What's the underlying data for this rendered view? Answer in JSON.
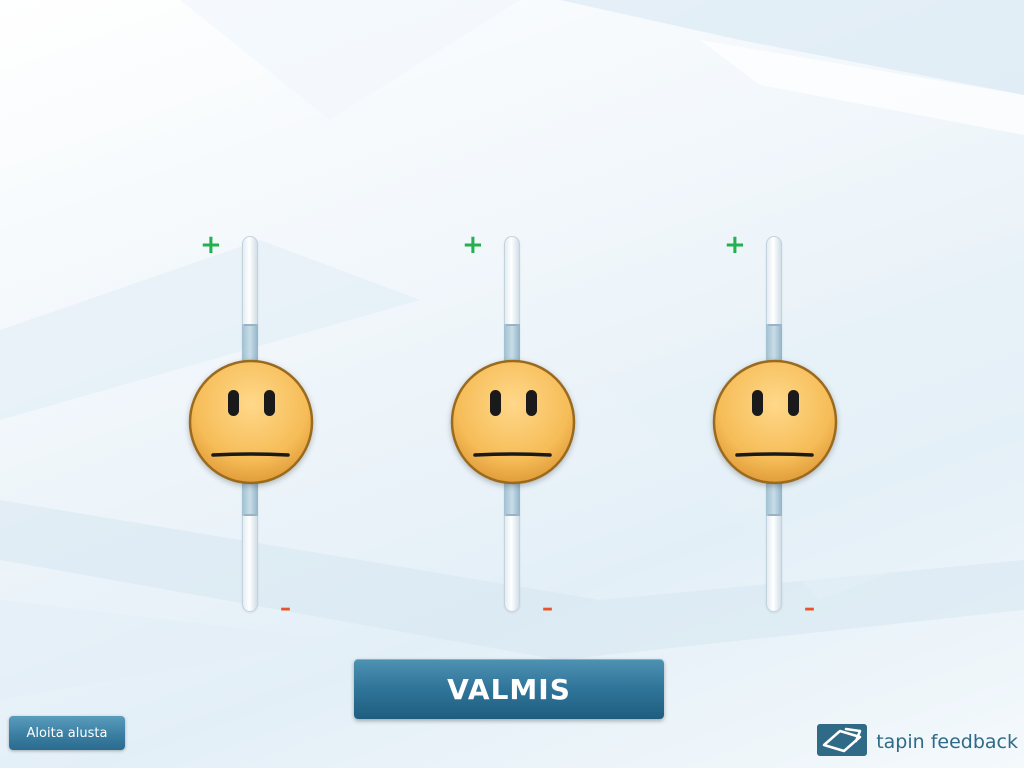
{
  "colors": {
    "plus": "#22b14c",
    "minus": "#e8542a",
    "face_fill": "#f6bd58",
    "face_outline": "#9a6a1e",
    "button_primary": "#2f7599",
    "brand": "#2f6a86"
  },
  "sliders": [
    {
      "plus_label": "+",
      "minus_label": "–",
      "face_icon": "neutral-face-icon",
      "level": 0.5
    },
    {
      "plus_label": "+",
      "minus_label": "–",
      "face_icon": "neutral-face-icon",
      "level": 0.5
    },
    {
      "plus_label": "+",
      "minus_label": "–",
      "face_icon": "neutral-face-icon",
      "level": 0.5
    }
  ],
  "actions": {
    "done_label": "VALMIS",
    "restart_label": "Aloita alusta"
  },
  "brand": {
    "name": "tapin feedback",
    "logo_icon": "tapin-logo-icon"
  }
}
